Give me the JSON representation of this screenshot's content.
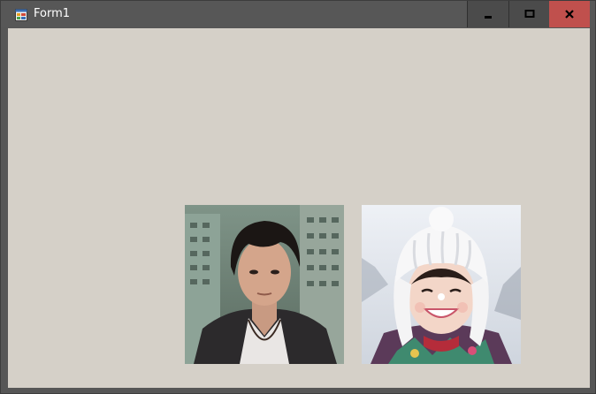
{
  "window": {
    "title": "Form1",
    "icon": "form-app-icon",
    "controls": {
      "minimize_icon": "minimize-icon",
      "maximize_icon": "maximize-icon",
      "close_icon": "close-icon",
      "close_color": "#c0504d"
    }
  },
  "client": {
    "background": "#d5d0c8",
    "pictures": [
      {
        "name": "picture-box-1"
      },
      {
        "name": "picture-box-2"
      }
    ]
  }
}
